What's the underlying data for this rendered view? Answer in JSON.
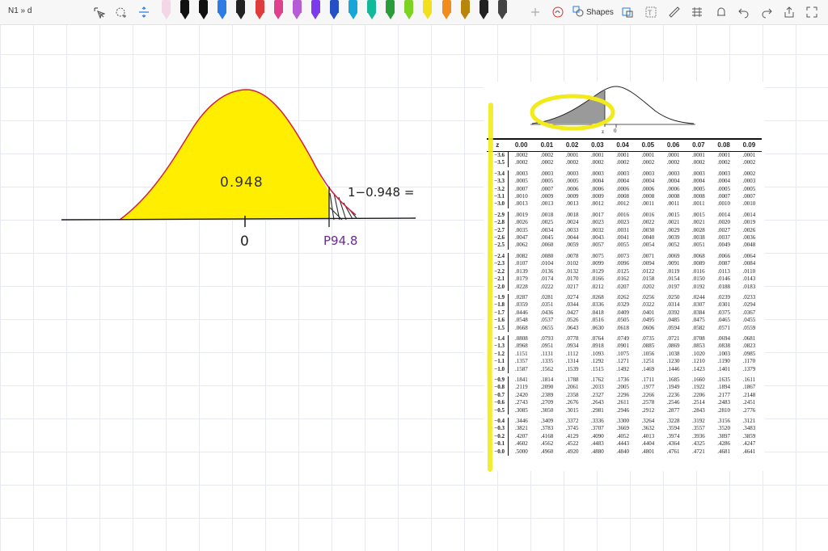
{
  "breadcrumb": "N1 » d",
  "toolbar": {
    "shapes_label": "Shapes",
    "icons": [
      "lasso-select-icon",
      "lasso-add-icon",
      "insert-space-icon",
      "add-pen-icon",
      "touch-draw-icon",
      "shapes-icon",
      "ink-to-shape-icon",
      "ruler-icon",
      "math-icon",
      "ink-replay-icon",
      "undo-icon",
      "redo-icon",
      "share-icon",
      "fullscreen-icon",
      "more-icon"
    ],
    "pen_colors": [
      "#f4d7e7",
      "#111111",
      "#111111",
      "#2d7be5",
      "#222222",
      "#e03c3c",
      "#e0408e",
      "#b55dd6",
      "#7c3aed",
      "#2450c7",
      "#17a6d8",
      "#14b89a",
      "#2a9d3a",
      "#7dd321",
      "#f2e01f",
      "#f28c1d",
      "#b8860b",
      "#222222",
      "#444444"
    ]
  },
  "drawing": {
    "label_area": "0.948",
    "label_complement": "1−0.948 =",
    "label_zero": "0",
    "label_percentile": "P94.8",
    "fill_color": "#ffee00",
    "curve_color": "#d61f3f",
    "percentile_color": "#6a2c91"
  },
  "table": {
    "header": [
      "z",
      "0.00",
      "0.01",
      "0.02",
      "0.03",
      "0.04",
      "0.05",
      "0.06",
      "0.07",
      "0.08",
      "0.09"
    ],
    "mini_labels": [
      "z",
      "0"
    ],
    "groups": [
      [
        [
          "−3.6",
          ".0002",
          ".0002",
          ".0001",
          ".0001",
          ".0001",
          ".0001",
          ".0001",
          ".0001",
          ".0001",
          ".0001"
        ],
        [
          "−3.5",
          ".0002",
          ".0002",
          ".0002",
          ".0002",
          ".0002",
          ".0002",
          ".0002",
          ".0002",
          ".0002",
          ".0002"
        ]
      ],
      [
        [
          "−3.4",
          ".0003",
          ".0003",
          ".0003",
          ".0003",
          ".0003",
          ".0003",
          ".0003",
          ".0003",
          ".0003",
          ".0002"
        ],
        [
          "−3.3",
          ".0005",
          ".0005",
          ".0005",
          ".0004",
          ".0004",
          ".0004",
          ".0004",
          ".0004",
          ".0004",
          ".0003"
        ],
        [
          "−3.2",
          ".0007",
          ".0007",
          ".0006",
          ".0006",
          ".0006",
          ".0006",
          ".0006",
          ".0005",
          ".0005",
          ".0005"
        ],
        [
          "−3.1",
          ".0010",
          ".0009",
          ".0009",
          ".0009",
          ".0008",
          ".0008",
          ".0008",
          ".0008",
          ".0007",
          ".0007"
        ],
        [
          "−3.0",
          ".0013",
          ".0013",
          ".0013",
          ".0012",
          ".0012",
          ".0011",
          ".0011",
          ".0011",
          ".0010",
          ".0010"
        ]
      ],
      [
        [
          "−2.9",
          ".0019",
          ".0018",
          ".0018",
          ".0017",
          ".0016",
          ".0016",
          ".0015",
          ".0015",
          ".0014",
          ".0014"
        ],
        [
          "−2.8",
          ".0026",
          ".0025",
          ".0024",
          ".0023",
          ".0023",
          ".0022",
          ".0021",
          ".0021",
          ".0020",
          ".0019"
        ],
        [
          "−2.7",
          ".0035",
          ".0034",
          ".0033",
          ".0032",
          ".0031",
          ".0030",
          ".0029",
          ".0028",
          ".0027",
          ".0026"
        ],
        [
          "−2.6",
          ".0047",
          ".0045",
          ".0044",
          ".0043",
          ".0041",
          ".0040",
          ".0039",
          ".0038",
          ".0037",
          ".0036"
        ],
        [
          "−2.5",
          ".0062",
          ".0060",
          ".0059",
          ".0057",
          ".0055",
          ".0054",
          ".0052",
          ".0051",
          ".0049",
          ".0048"
        ]
      ],
      [
        [
          "−2.4",
          ".0082",
          ".0080",
          ".0078",
          ".0075",
          ".0073",
          ".0071",
          ".0069",
          ".0068",
          ".0066",
          ".0064"
        ],
        [
          "−2.3",
          ".0107",
          ".0104",
          ".0102",
          ".0099",
          ".0096",
          ".0094",
          ".0091",
          ".0089",
          ".0087",
          ".0084"
        ],
        [
          "−2.2",
          ".0139",
          ".0136",
          ".0132",
          ".0129",
          ".0125",
          ".0122",
          ".0119",
          ".0116",
          ".0113",
          ".0110"
        ],
        [
          "−2.1",
          ".0179",
          ".0174",
          ".0170",
          ".0166",
          ".0162",
          ".0158",
          ".0154",
          ".0150",
          ".0146",
          ".0143"
        ],
        [
          "−2.0",
          ".0228",
          ".0222",
          ".0217",
          ".0212",
          ".0207",
          ".0202",
          ".0197",
          ".0192",
          ".0188",
          ".0183"
        ]
      ],
      [
        [
          "−1.9",
          ".0287",
          ".0281",
          ".0274",
          ".0268",
          ".0262",
          ".0256",
          ".0250",
          ".0244",
          ".0239",
          ".0233"
        ],
        [
          "−1.8",
          ".0359",
          ".0351",
          ".0344",
          ".0336",
          ".0329",
          ".0322",
          ".0314",
          ".0307",
          ".0301",
          ".0294"
        ],
        [
          "−1.7",
          ".0446",
          ".0436",
          ".0427",
          ".0418",
          ".0409",
          ".0401",
          ".0392",
          ".0384",
          ".0375",
          ".0367"
        ],
        [
          "−1.6",
          ".0548",
          ".0537",
          ".0526",
          ".0516",
          ".0505",
          ".0495",
          ".0485",
          ".0475",
          ".0465",
          ".0455"
        ],
        [
          "−1.5",
          ".0668",
          ".0655",
          ".0643",
          ".0630",
          ".0618",
          ".0606",
          ".0594",
          ".0582",
          ".0571",
          ".0559"
        ]
      ],
      [
        [
          "−1.4",
          ".0808",
          ".0793",
          ".0778",
          ".0764",
          ".0749",
          ".0735",
          ".0721",
          ".0708",
          ".0694",
          ".0681"
        ],
        [
          "−1.3",
          ".0968",
          ".0951",
          ".0934",
          ".0918",
          ".0901",
          ".0885",
          ".0869",
          ".0853",
          ".0838",
          ".0823"
        ],
        [
          "−1.2",
          ".1151",
          ".1131",
          ".1112",
          ".1093",
          ".1075",
          ".1056",
          ".1038",
          ".1020",
          ".1003",
          ".0985"
        ],
        [
          "−1.1",
          ".1357",
          ".1335",
          ".1314",
          ".1292",
          ".1271",
          ".1251",
          ".1230",
          ".1210",
          ".1190",
          ".1170"
        ],
        [
          "−1.0",
          ".1587",
          ".1562",
          ".1539",
          ".1515",
          ".1492",
          ".1469",
          ".1446",
          ".1423",
          ".1401",
          ".1379"
        ]
      ],
      [
        [
          "−0.9",
          ".1841",
          ".1814",
          ".1788",
          ".1762",
          ".1736",
          ".1711",
          ".1685",
          ".1660",
          ".1635",
          ".1611"
        ],
        [
          "−0.8",
          ".2119",
          ".2090",
          ".2061",
          ".2033",
          ".2005",
          ".1977",
          ".1949",
          ".1922",
          ".1894",
          ".1867"
        ],
        [
          "−0.7",
          ".2420",
          ".2389",
          ".2358",
          ".2327",
          ".2296",
          ".2266",
          ".2236",
          ".2206",
          ".2177",
          ".2148"
        ],
        [
          "−0.6",
          ".2743",
          ".2709",
          ".2676",
          ".2643",
          ".2611",
          ".2578",
          ".2546",
          ".2514",
          ".2483",
          ".2451"
        ],
        [
          "−0.5",
          ".3085",
          ".3050",
          ".3015",
          ".2981",
          ".2946",
          ".2912",
          ".2877",
          ".2843",
          ".2810",
          ".2776"
        ]
      ],
      [
        [
          "−0.4",
          ".3446",
          ".3409",
          ".3372",
          ".3336",
          ".3300",
          ".3264",
          ".3228",
          ".3192",
          ".3156",
          ".3121"
        ],
        [
          "−0.3",
          ".3821",
          ".3783",
          ".3745",
          ".3707",
          ".3669",
          ".3632",
          ".3594",
          ".3557",
          ".3520",
          ".3483"
        ],
        [
          "−0.2",
          ".4207",
          ".4168",
          ".4129",
          ".4090",
          ".4052",
          ".4013",
          ".3974",
          ".3936",
          ".3897",
          ".3859"
        ],
        [
          "−0.1",
          ".4602",
          ".4562",
          ".4522",
          ".4483",
          ".4443",
          ".4404",
          ".4364",
          ".4325",
          ".4286",
          ".4247"
        ],
        [
          "−0.0",
          ".5000",
          ".4960",
          ".4920",
          ".4880",
          ".4840",
          ".4801",
          ".4761",
          ".4721",
          ".4681",
          ".4641"
        ]
      ]
    ]
  }
}
